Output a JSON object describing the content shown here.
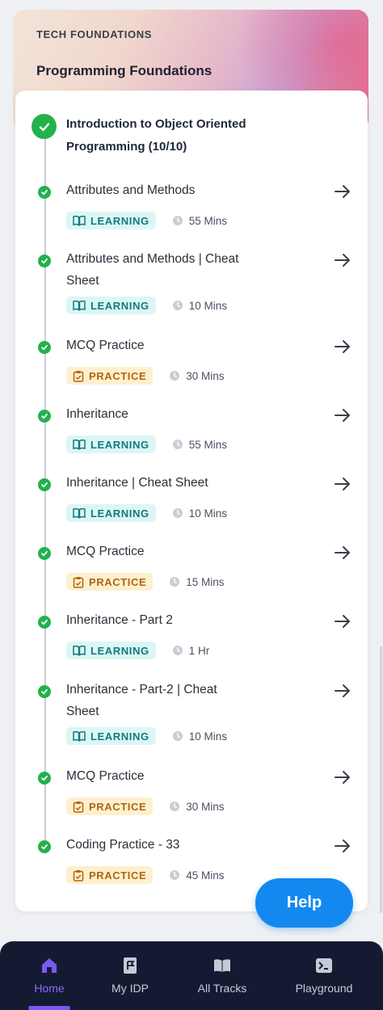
{
  "header": {
    "track_label": "TECH FOUNDATIONS",
    "course_title": "Programming Foundations"
  },
  "module": {
    "title": "Introduction to Object Oriented Programming (10/10)"
  },
  "items": [
    {
      "title": "Attributes and Methods",
      "tag": "LEARNING",
      "duration": "55 Mins",
      "kind": "learning"
    },
    {
      "title": "Attributes and Methods | Cheat Sheet",
      "tag": "LEARNING",
      "duration": "10 Mins",
      "kind": "learning"
    },
    {
      "title": "MCQ Practice",
      "tag": "PRACTICE",
      "duration": "30 Mins",
      "kind": "practice"
    },
    {
      "title": "Inheritance",
      "tag": "LEARNING",
      "duration": "55 Mins",
      "kind": "learning"
    },
    {
      "title": "Inheritance | Cheat Sheet",
      "tag": "LEARNING",
      "duration": "10 Mins",
      "kind": "learning"
    },
    {
      "title": "MCQ Practice",
      "tag": "PRACTICE",
      "duration": "15 Mins",
      "kind": "practice"
    },
    {
      "title": "Inheritance - Part 2",
      "tag": "LEARNING",
      "duration": "1 Hr",
      "kind": "learning"
    },
    {
      "title": "Inheritance - Part-2 | Cheat Sheet",
      "tag": "LEARNING",
      "duration": "10 Mins",
      "kind": "learning"
    },
    {
      "title": "MCQ Practice",
      "tag": "PRACTICE",
      "duration": "30 Mins",
      "kind": "practice"
    },
    {
      "title": "Coding Practice - 33",
      "tag": "PRACTICE",
      "duration": "45 Mins",
      "kind": "practice"
    }
  ],
  "help_button": {
    "label": "Help"
  },
  "bottom_nav": [
    {
      "label": "Home",
      "icon": "home-icon",
      "active": true
    },
    {
      "label": "My IDP",
      "icon": "flag-document-icon",
      "active": false
    },
    {
      "label": "All Tracks",
      "icon": "open-book-icon",
      "active": false
    },
    {
      "label": "Playground",
      "icon": "terminal-icon",
      "active": false
    }
  ],
  "colors": {
    "completed": "#22b24c",
    "learning_bg": "#dcf6f6",
    "learning_text": "#137a7a",
    "practice_bg": "#fdf0cf",
    "practice_text": "#b4640d",
    "help": "#1389f0",
    "nav_bg": "#151a33",
    "nav_active": "#8c6cf4"
  }
}
